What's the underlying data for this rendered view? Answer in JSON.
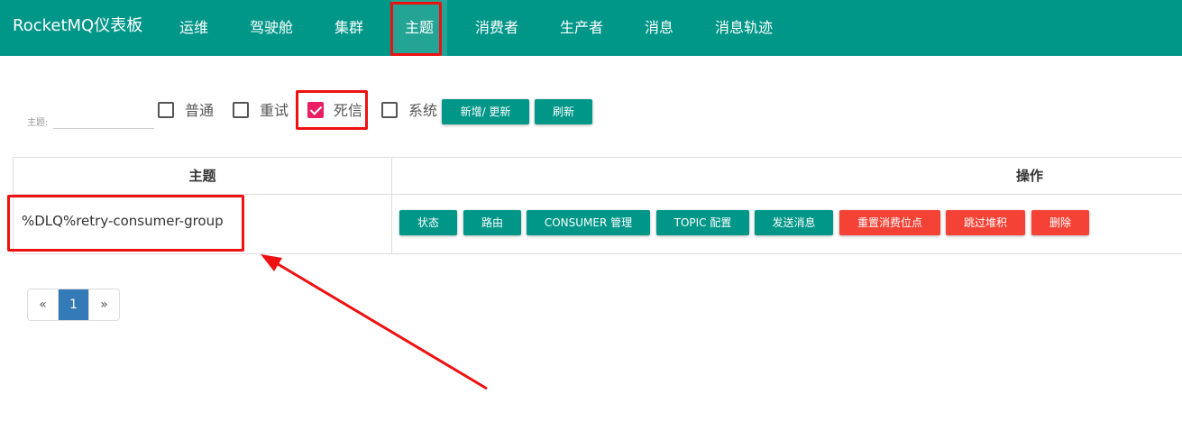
{
  "navbar": {
    "brand": "RocketMQ仪表板",
    "items": [
      "运维",
      "驾驶舱",
      "集群",
      "主题",
      "消费者",
      "生产者",
      "消息",
      "消息轨迹"
    ],
    "active_item": "主题",
    "background_color": "#009688"
  },
  "filter": {
    "label": "主题:",
    "input_value": "",
    "checkboxes": [
      {
        "label": "普通",
        "checked": false
      },
      {
        "label": "重试",
        "checked": false
      },
      {
        "label": "死信",
        "checked": true
      },
      {
        "label": "系统",
        "checked": false
      }
    ],
    "add_update_button": "新增/ 更新",
    "refresh_button": "刷新"
  },
  "table": {
    "headers": {
      "topic": "主题",
      "operation": "操作"
    },
    "rows": [
      {
        "topic": "%DLQ%retry-consumer-group",
        "actions": [
          {
            "label": "状态",
            "style": "teal"
          },
          {
            "label": "路由",
            "style": "teal"
          },
          {
            "label": "CONSUMER 管理",
            "style": "teal"
          },
          {
            "label": "TOPIC 配置",
            "style": "teal"
          },
          {
            "label": "发送消息",
            "style": "teal"
          },
          {
            "label": "重置消费位点",
            "style": "red"
          },
          {
            "label": "跳过堆积",
            "style": "red"
          },
          {
            "label": "删除",
            "style": "red"
          }
        ]
      }
    ]
  },
  "pagination": {
    "prev": "«",
    "current_page": "1",
    "next": "»"
  },
  "colors": {
    "primary": "#009688",
    "danger": "#f44336",
    "checkbox_checked": "#e91e63",
    "page_active": "#337ab7",
    "annotation": "#ee1111"
  }
}
